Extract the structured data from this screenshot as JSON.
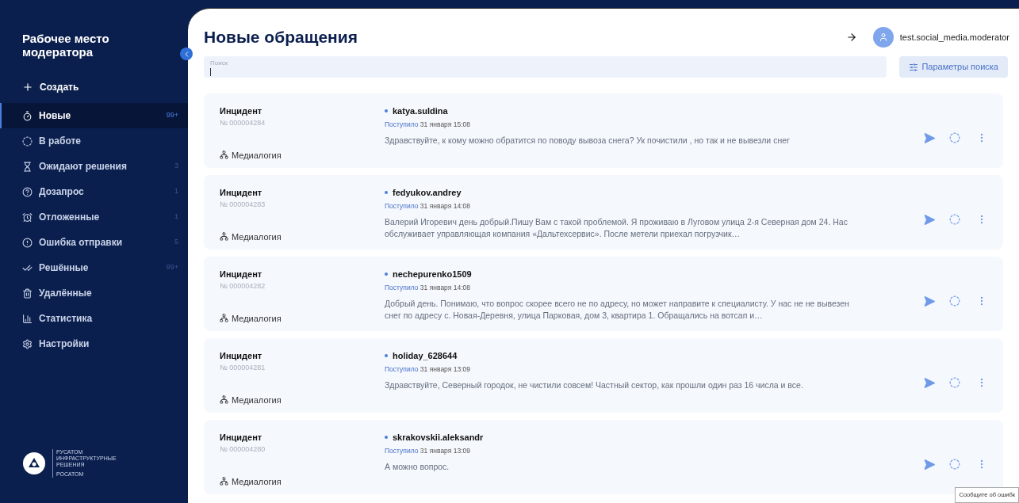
{
  "sidebar": {
    "title": "Рабочее место модератора",
    "create": "Создать",
    "items": [
      {
        "label": "Новые",
        "count": "99+",
        "selected": true
      },
      {
        "label": "В работе",
        "selected": false
      },
      {
        "label": "Ожидают решения",
        "count": "3",
        "selected": false
      },
      {
        "label": "Дозапрос",
        "count": "1",
        "selected": false
      },
      {
        "label": "Отложенные",
        "count": "1",
        "selected": false
      },
      {
        "label": "Ошибка отправки",
        "count": "5",
        "selected": false
      },
      {
        "label": "Решённые",
        "count": "99+",
        "selected": false
      },
      {
        "label": "Удалённые",
        "selected": false
      },
      {
        "label": "Статистика",
        "selected": false
      },
      {
        "label": "Настройки",
        "selected": false
      }
    ],
    "logo": {
      "lines": [
        "РУСАТОМ",
        "ИНФРАСТРУКТУРНЫЕ",
        "РЕШЕНИЯ"
      ],
      "sub": "РОСАТОМ"
    }
  },
  "header": {
    "title": "Новые обращения",
    "user": "test.social_media.moderator"
  },
  "search": {
    "label": "Поиск",
    "button": "Параметры поиска"
  },
  "cards": [
    {
      "type": "Инцидент",
      "number": "№ 000004284",
      "source": "Медиалогия",
      "author": "katya.suldina",
      "received": "Поступило",
      "date": "31 января 15:08",
      "text": "Здравствуйте, к кому можно обратится по поводу вывоза снега? Ук почистили , но так и не вывезли снег"
    },
    {
      "type": "Инцидент",
      "number": "№ 000004283",
      "source": "Медиалогия",
      "author": "fedyukov.andrey",
      "received": "Поступило",
      "date": "31 января 14:08",
      "text": "Валерий Игоревич день добрый.Пишу Вам с такой проблемой. Я проживаю в Луговом улица 2-я Северная дом 24. Нас обслуживает управляющая компания «Дальтехсервис». После метели приехал погрузчик…"
    },
    {
      "type": "Инцидент",
      "number": "№ 000004282",
      "source": "Медиалогия",
      "author": "nechepurenko1509",
      "received": "Поступило",
      "date": "31 января 14:08",
      "text": "Добрый день. Понимаю, что вопрос скорее всего не по адресу, но может направите к специалисту. У нас не не вывезен снег по адресу с. Новая-Деревня, улица Парковая, дом 3, квартира 1. Обращались на вотсап и…"
    },
    {
      "type": "Инцидент",
      "number": "№ 000004281",
      "source": "Медиалогия",
      "author": "holiday_628644",
      "received": "Поступило",
      "date": "31 января 13:09",
      "text": "Здравствуйте, Северный городок, не чистили совсем! Частный сектор, как прошли один раз 16 числа и все."
    },
    {
      "type": "Инцидент",
      "number": "№ 000004280",
      "source": "Медиалогия",
      "author": "skrakovskii.aleksandr",
      "received": "Поступило",
      "date": "31 января 13:09",
      "text": "А можно вопрос."
    }
  ],
  "tooltip": "Сообщите об ошибк"
}
